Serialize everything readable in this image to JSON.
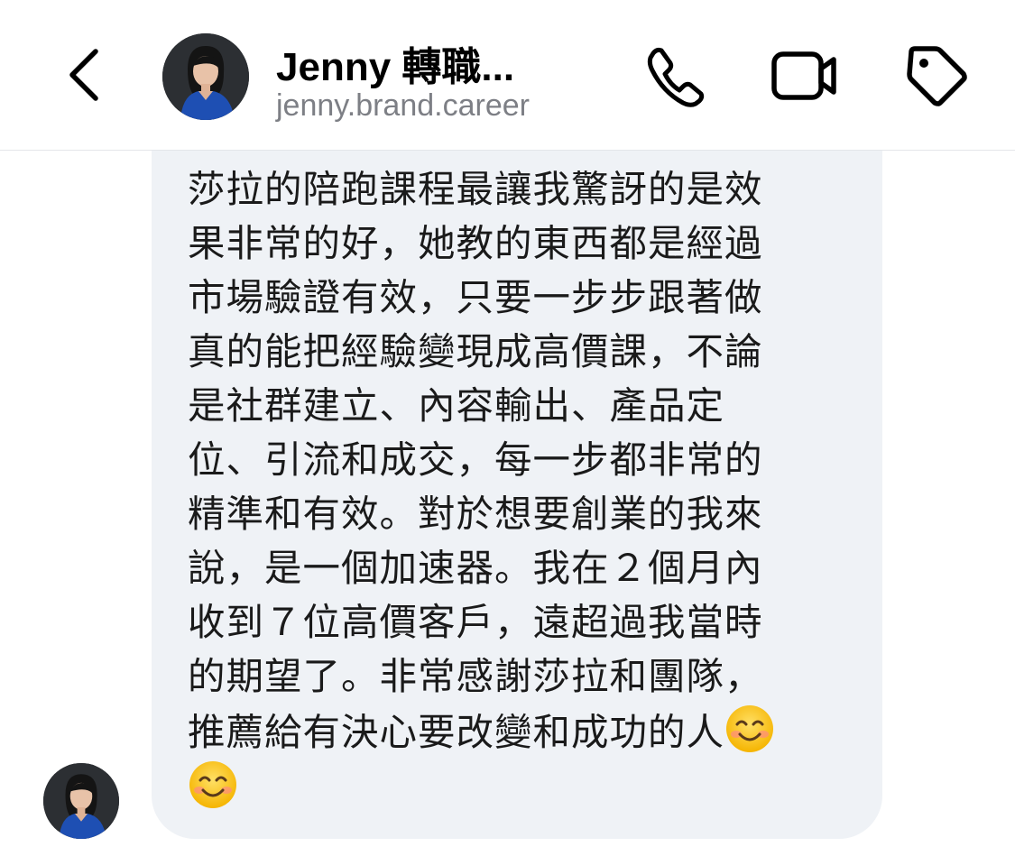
{
  "header": {
    "title": "Jenny 轉職...",
    "subtitle": "jenny.brand.career",
    "back_icon": "chevron-left-icon",
    "phone_icon": "phone-icon",
    "video_icon": "video-camera-icon",
    "tag_icon": "tag-icon"
  },
  "message": {
    "lines": [
      "莎拉的陪跑課程最讓我驚訝的是效",
      "果非常的好，她教的東西都是經過",
      "市場驗證有效，只要一步步跟著做",
      "真的能把經驗變現成高價課，不論",
      "是社群建立、內容輸出、產品定",
      "位、引流和成交，每一步都非常的",
      "精準和有效。對於想要創業的我來",
      "說，是一個加速器。我在２個月內",
      "收到７位高價客戶，遠超過我當時",
      "的期望了。非常感謝莎拉和團隊，",
      "推薦給有決心要改變和成功的人"
    ],
    "emoji_icon": "smiling-face-emoji"
  },
  "colors": {
    "bubble_bg": "#eff2f6",
    "subtitle": "#7d7f85",
    "icon_stroke": "#000000"
  }
}
